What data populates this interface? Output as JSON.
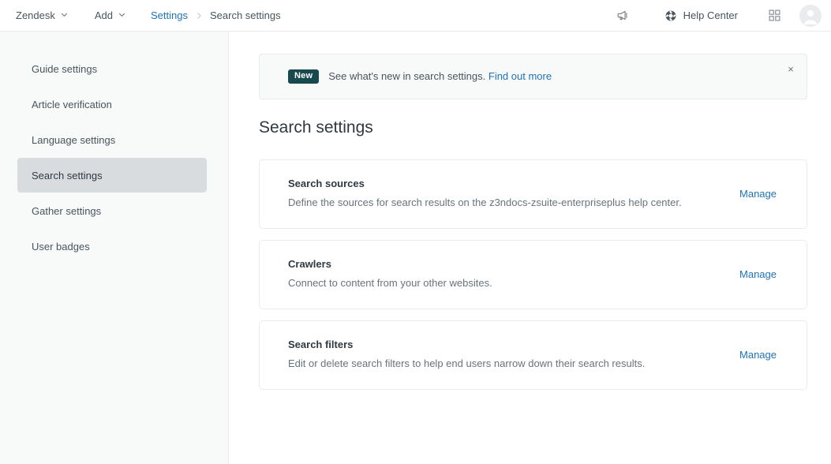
{
  "topbar": {
    "product_menu": {
      "label": "Zendesk",
      "icon": "chevron-down-icon"
    },
    "add_menu": {
      "label": "Add",
      "icon": "chevron-down-icon"
    },
    "breadcrumb": {
      "parent": "Settings",
      "separator": "›",
      "current": "Search settings"
    },
    "announcements_icon": "megaphone-icon",
    "help_center": {
      "label": "Help Center",
      "icon": "lifebuoy-icon"
    },
    "apps_icon": "grid-apps-icon",
    "avatar": "user-avatar-icon"
  },
  "sidebar": {
    "items": [
      {
        "label": "Guide settings",
        "selected": false
      },
      {
        "label": "Article verification",
        "selected": false
      },
      {
        "label": "Language settings",
        "selected": false
      },
      {
        "label": "Search settings",
        "selected": true
      },
      {
        "label": "Gather settings",
        "selected": false
      },
      {
        "label": "User badges",
        "selected": false
      }
    ]
  },
  "banner": {
    "badge": "New",
    "text": "See what's new in search settings.",
    "link_label": "Find out more",
    "close_icon": "close-icon",
    "close_glyph": "×"
  },
  "main": {
    "page_title": "Search settings",
    "cards": [
      {
        "title": "Search sources",
        "description": "Define the sources for search results on the z3ndocs-zsuite-enterpriseplus help center.",
        "action_label": "Manage"
      },
      {
        "title": "Crawlers",
        "description": "Connect to content from your other websites.",
        "action_label": "Manage"
      },
      {
        "title": "Search filters",
        "description": "Edit or delete search filters to help end users narrow down their search results.",
        "action_label": "Manage"
      }
    ]
  },
  "colors": {
    "link_blue": "#1f73b7",
    "badge_dark_teal": "#17494d",
    "sidebar_bg": "#f8f9f9",
    "selected_nav_bg": "#d8dcde",
    "border_gray": "#e9ebed",
    "text_primary": "#2f3941",
    "text_secondary": "#68737d"
  }
}
